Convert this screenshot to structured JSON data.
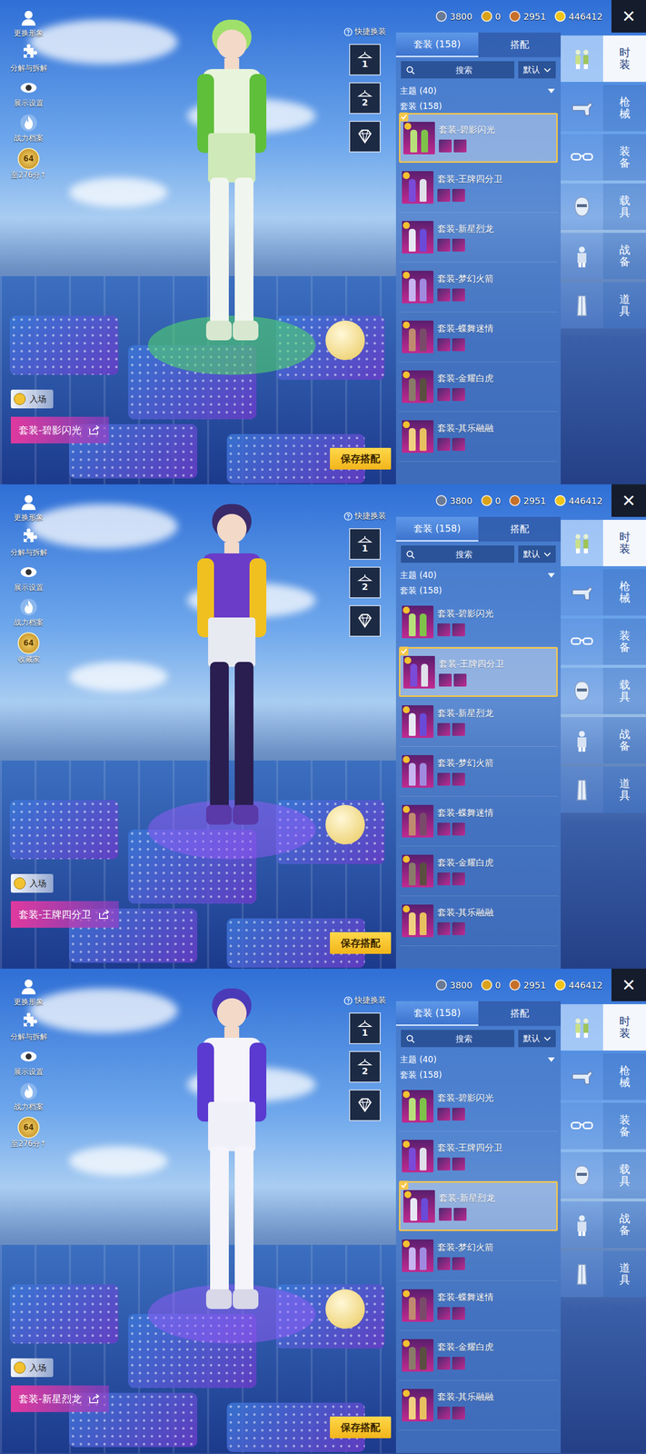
{
  "panels": [
    {
      "hud": {
        "menu": [
          {
            "label": "更换形象"
          },
          {
            "label": "分解与拆解"
          },
          {
            "label": "展示设置"
          },
          {
            "label": "战力档案"
          }
        ],
        "rank": {
          "badge": "64",
          "label": "至276分↑"
        }
      },
      "currencies": [
        {
          "value": "3800"
        },
        {
          "value": "0"
        },
        {
          "value": "2951"
        },
        {
          "value": "446412"
        }
      ],
      "close": "✕",
      "quick": {
        "label": "快捷换装",
        "slots": [
          "1",
          "2"
        ]
      },
      "entrance": "入场",
      "current_outfit": "套装-碧影闪光",
      "save": "保存搭配",
      "tabs": [
        {
          "label": "套装 (158)",
          "selected": true
        },
        {
          "label": "搭配",
          "selected": false
        }
      ],
      "search": {
        "placeholder": "搜索"
      },
      "sort": "默认",
      "sections": [
        "主题 (40)",
        "套装 (158)"
      ],
      "outfits": [
        {
          "name": "套装-碧影闪光",
          "selected": true
        },
        {
          "name": "套装-王牌四分卫",
          "selected": false
        },
        {
          "name": "套装-新星烈龙",
          "selected": false
        },
        {
          "name": "套装-梦幻火箭",
          "selected": false
        },
        {
          "name": "套装-蝶舞迷情",
          "selected": false
        },
        {
          "name": "套装-金耀白虎",
          "selected": false
        },
        {
          "name": "套装-其乐融融",
          "selected": false
        }
      ],
      "categories": [
        {
          "label": "时装",
          "selected": true
        },
        {
          "label": "枪械",
          "selected": false
        },
        {
          "label": "装备",
          "selected": false
        },
        {
          "label": "载具",
          "selected": false
        },
        {
          "label": "战备",
          "selected": false
        },
        {
          "label": "道具",
          "selected": false
        }
      ]
    },
    {
      "hud": {
        "menu": [
          {
            "label": "更换形象"
          },
          {
            "label": "分解与拆解"
          },
          {
            "label": "展示设置"
          },
          {
            "label": "战力档案"
          }
        ],
        "rank": {
          "badge": "64",
          "label": "收藏家"
        }
      },
      "currencies": [
        {
          "value": "3800"
        },
        {
          "value": "0"
        },
        {
          "value": "2951"
        },
        {
          "value": "446412"
        }
      ],
      "close": "✕",
      "quick": {
        "label": "快捷换装",
        "slots": [
          "1",
          "2"
        ]
      },
      "entrance": "入场",
      "current_outfit": "套装-王牌四分卫",
      "save": "保存搭配",
      "tabs": [
        {
          "label": "套装 (158)",
          "selected": true
        },
        {
          "label": "搭配",
          "selected": false
        }
      ],
      "search": {
        "placeholder": "搜索"
      },
      "sort": "默认",
      "sections": [
        "主题 (40)",
        "套装 (158)"
      ],
      "outfits": [
        {
          "name": "套装-碧影闪光",
          "selected": false
        },
        {
          "name": "套装-王牌四分卫",
          "selected": true
        },
        {
          "name": "套装-新星烈龙",
          "selected": false
        },
        {
          "name": "套装-梦幻火箭",
          "selected": false
        },
        {
          "name": "套装-蝶舞迷情",
          "selected": false
        },
        {
          "name": "套装-金耀白虎",
          "selected": false
        },
        {
          "name": "套装-其乐融融",
          "selected": false
        }
      ],
      "categories": [
        {
          "label": "时装",
          "selected": true
        },
        {
          "label": "枪械",
          "selected": false
        },
        {
          "label": "装备",
          "selected": false
        },
        {
          "label": "载具",
          "selected": false
        },
        {
          "label": "战备",
          "selected": false
        },
        {
          "label": "道具",
          "selected": false
        }
      ]
    },
    {
      "hud": {
        "menu": [
          {
            "label": "更换形象"
          },
          {
            "label": "分解与拆解"
          },
          {
            "label": "展示设置"
          },
          {
            "label": "战力档案"
          }
        ],
        "rank": {
          "badge": "64",
          "label": "至276分↑"
        }
      },
      "currencies": [
        {
          "value": "3800"
        },
        {
          "value": "0"
        },
        {
          "value": "2951"
        },
        {
          "value": "446412"
        }
      ],
      "close": "✕",
      "quick": {
        "label": "快捷换装",
        "slots": [
          "1",
          "2"
        ]
      },
      "entrance": "入场",
      "current_outfit": "套装-新星烈龙",
      "save": "保存搭配",
      "tabs": [
        {
          "label": "套装 (158)",
          "selected": true
        },
        {
          "label": "搭配",
          "selected": false
        }
      ],
      "search": {
        "placeholder": "搜索"
      },
      "sort": "默认",
      "sections": [
        "主题 (40)",
        "套装 (158)"
      ],
      "outfits": [
        {
          "name": "套装-碧影闪光",
          "selected": false
        },
        {
          "name": "套装-王牌四分卫",
          "selected": false
        },
        {
          "name": "套装-新星烈龙",
          "selected": true
        },
        {
          "name": "套装-梦幻火箭",
          "selected": false
        },
        {
          "name": "套装-蝶舞迷情",
          "selected": false
        },
        {
          "name": "套装-金耀白虎",
          "selected": false
        },
        {
          "name": "套装-其乐融融",
          "selected": false
        }
      ],
      "categories": [
        {
          "label": "时装",
          "selected": true
        },
        {
          "label": "枪械",
          "selected": false
        },
        {
          "label": "装备",
          "selected": false
        },
        {
          "label": "载具",
          "selected": false
        },
        {
          "label": "战备",
          "selected": false
        },
        {
          "label": "道具",
          "selected": false
        }
      ]
    }
  ]
}
